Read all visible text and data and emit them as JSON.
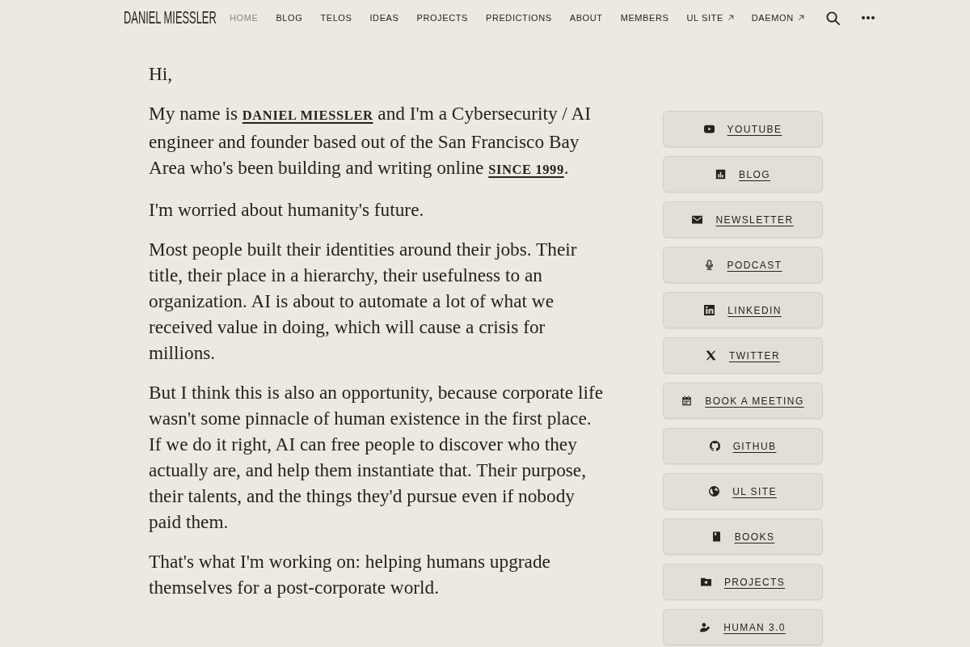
{
  "nav": {
    "logo": "DANIEL MIESSLER",
    "items": [
      {
        "label": "HOME",
        "selected": true,
        "external": false
      },
      {
        "label": "BLOG",
        "selected": false,
        "external": false
      },
      {
        "label": "TELOS",
        "selected": false,
        "external": false
      },
      {
        "label": "IDEAS",
        "selected": false,
        "external": false
      },
      {
        "label": "PROJECTS",
        "selected": false,
        "external": false
      },
      {
        "label": "PREDICTIONS",
        "selected": false,
        "external": false
      },
      {
        "label": "ABOUT",
        "selected": false,
        "external": false
      },
      {
        "label": "MEMBERS",
        "selected": false,
        "external": false
      },
      {
        "label": "UL SITE",
        "selected": false,
        "external": true
      },
      {
        "label": "DAEMON",
        "selected": false,
        "external": true
      }
    ]
  },
  "article": {
    "paragraphs": [
      {
        "parts": [
          {
            "kind": "text",
            "text": "Hi,"
          }
        ]
      },
      {
        "parts": [
          {
            "kind": "text",
            "text": "My name is "
          },
          {
            "kind": "link",
            "text": "DANIEL MIESSLER"
          },
          {
            "kind": "text",
            "text": " and I'm a Cybersecurity / AI engineer and founder based out of the San Francisco Bay Area who's been building and writing online "
          },
          {
            "kind": "link",
            "text": "SINCE 1999"
          },
          {
            "kind": "text",
            "text": "."
          }
        ]
      },
      {
        "parts": [
          {
            "kind": "text",
            "text": "I'm worried about humanity's future."
          }
        ]
      },
      {
        "parts": [
          {
            "kind": "text",
            "text": "Most people built their identities around their jobs. Their title, their place in a hierarchy, their usefulness to an organization. AI is about to automate a lot of what we received value in doing, which will cause a crisis for millions."
          }
        ]
      },
      {
        "parts": [
          {
            "kind": "text",
            "text": "But I think this is also an opportunity, because corporate life wasn't some pinnacle of human existence in the first place. If we do it right, AI can free people to discover who they actually are, and help them instantiate that. Their purpose, their talents, and the things they'd pursue even if nobody paid them."
          }
        ]
      },
      {
        "parts": [
          {
            "kind": "text",
            "text": "That's what I'm working on: helping humans upgrade themselves for a post-corporate world."
          }
        ]
      }
    ]
  },
  "sidebar": {
    "buttons": [
      {
        "label": "YOUTUBE",
        "kind": "youtube"
      },
      {
        "label": "BLOG",
        "kind": "blog"
      },
      {
        "label": "NEWSLETTER",
        "kind": "newsletter"
      },
      {
        "label": "PODCAST",
        "kind": "podcast"
      },
      {
        "label": "LINKEDIN",
        "kind": "linkedin"
      },
      {
        "label": "TWITTER",
        "kind": "twitter"
      },
      {
        "label": "BOOK A MEETING",
        "kind": "calendar"
      },
      {
        "label": "GITHUB",
        "kind": "github"
      },
      {
        "label": "UL SITE",
        "kind": "globe"
      },
      {
        "label": "BOOKS",
        "kind": "book"
      },
      {
        "label": "PROJECTS",
        "kind": "folder"
      },
      {
        "label": "HUMAN 3.0",
        "kind": "person"
      }
    ]
  }
}
